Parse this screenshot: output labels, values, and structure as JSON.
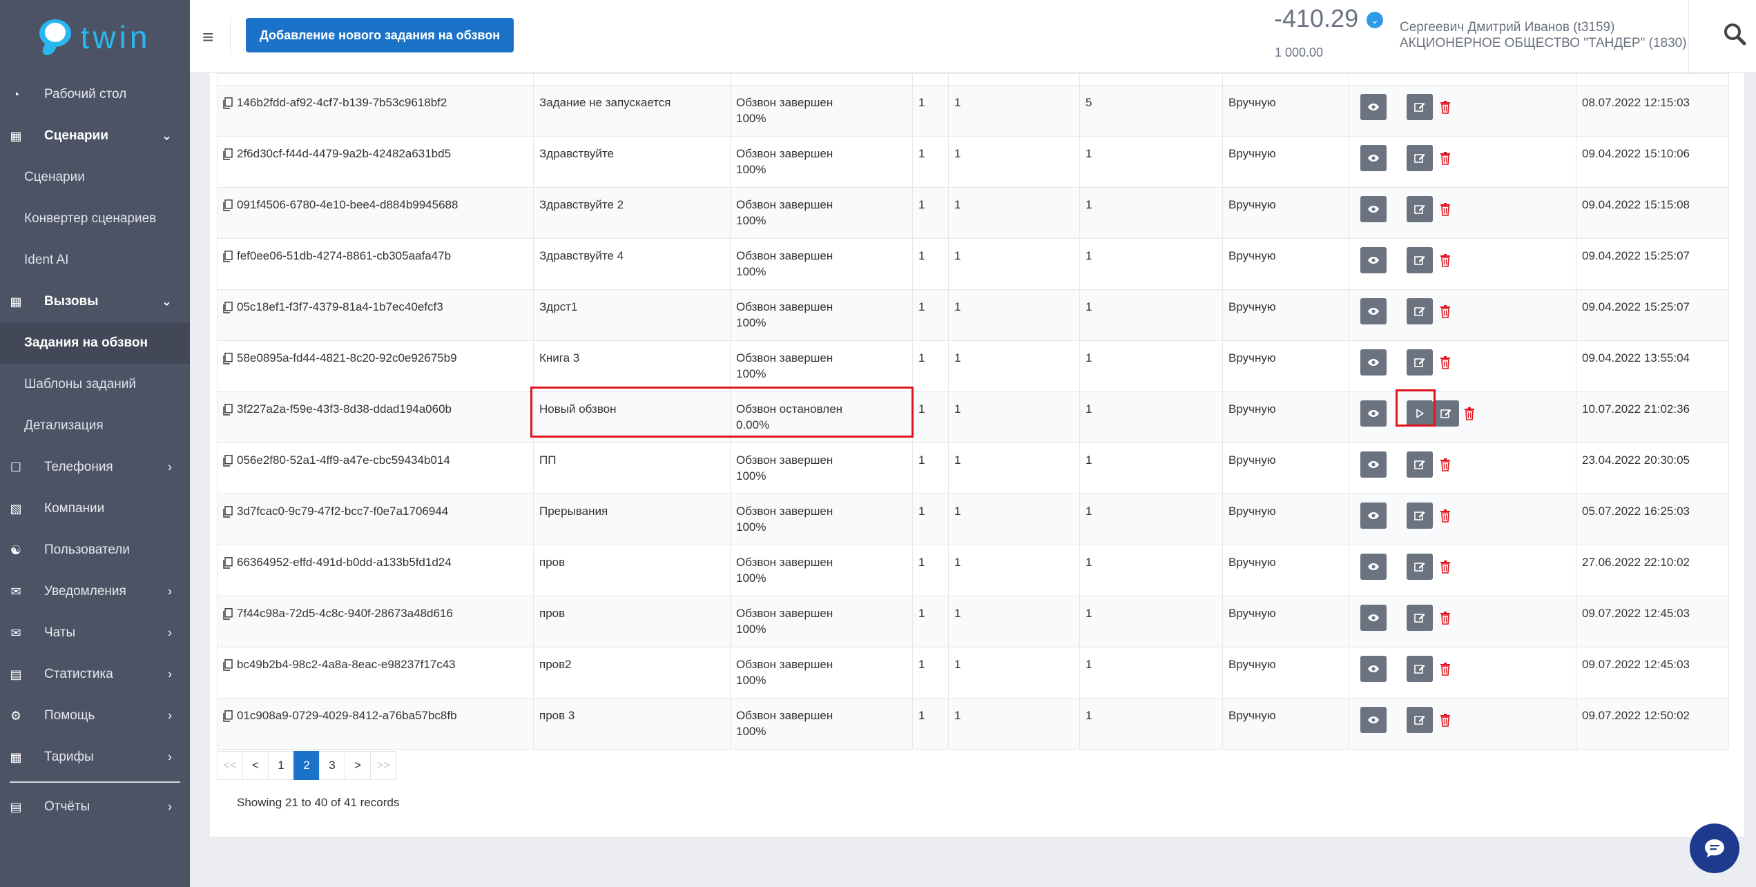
{
  "brand": {
    "name": "twin"
  },
  "sidebar": {
    "items": [
      {
        "label": "Рабочий стол",
        "icon": "dashboard-icon"
      },
      {
        "label": "Сценарии",
        "icon": "scenario-icon",
        "arrow": "chevron-down-icon"
      },
      {
        "label": "Сценарии",
        "sub": true
      },
      {
        "label": "Конвертер сценариев",
        "sub": true
      },
      {
        "label": "Ident AI",
        "sub": true
      },
      {
        "label": "Вызовы",
        "icon": "calendar-icon",
        "arrow": "chevron-down-icon"
      },
      {
        "label": "Задания на обзвон",
        "sub": true,
        "active": true
      },
      {
        "label": "Шаблоны заданий",
        "sub": true
      },
      {
        "label": "Детализация",
        "sub": true
      },
      {
        "label": "Телефония",
        "icon": "phone-icon",
        "arrow": "chevron-right-icon"
      },
      {
        "label": "Компании",
        "icon": "building-icon"
      },
      {
        "label": "Пользователи",
        "icon": "users-icon"
      },
      {
        "label": "Уведомления",
        "icon": "envelope-icon",
        "arrow": "chevron-right-icon"
      },
      {
        "label": "Чаты",
        "icon": "chat-icon",
        "arrow": "chevron-right-icon"
      },
      {
        "label": "Статистика",
        "icon": "bar-chart-icon",
        "arrow": "chevron-right-icon"
      },
      {
        "label": "Помощь",
        "icon": "cogs-icon",
        "arrow": "chevron-right-icon"
      },
      {
        "label": "Тарифы",
        "icon": "calculator-icon",
        "arrow": "chevron-right-icon"
      },
      {
        "label": "Отчёты",
        "icon": "report-chart-icon",
        "arrow": "chevron-right-icon"
      }
    ]
  },
  "header": {
    "add_task_label": "Добавление нового задания на обзвон",
    "balance": "-410.29",
    "credit": "1 000.00",
    "user_name": "Сергеевич Дмитрий Иванов (t3159)",
    "company": "АКЦИОНЕРНОЕ ОБЩЕСТВО \"ТАНДЕР\" (1830)"
  },
  "table": {
    "rows": [
      {
        "id": "146b2fdd-af92-4cf7-b139-7b53c9618bf2",
        "name": "Задание не запускается",
        "status": "Обзвон завершен",
        "progress": "100%",
        "c1": "1",
        "c2": "1",
        "c3": "5",
        "mode": "Вручную",
        "date": "08.07.2022 12:15:03",
        "play": false
      },
      {
        "id": "2f6d30cf-f44d-4479-9a2b-42482a631bd5",
        "name": "Здравствуйте",
        "status": "Обзвон завершен",
        "progress": "100%",
        "c1": "1",
        "c2": "1",
        "c3": "1",
        "mode": "Вручную",
        "date": "09.04.2022 15:10:06",
        "play": false
      },
      {
        "id": "091f4506-6780-4e10-bee4-d884b9945688",
        "name": "Здравствуйте 2",
        "status": "Обзвон завершен",
        "progress": "100%",
        "c1": "1",
        "c2": "1",
        "c3": "1",
        "mode": "Вручную",
        "date": "09.04.2022 15:15:08",
        "play": false
      },
      {
        "id": "fef0ee06-51db-4274-8861-cb305aafa47b",
        "name": "Здравствуйте 4",
        "status": "Обзвон завершен",
        "progress": "100%",
        "c1": "1",
        "c2": "1",
        "c3": "1",
        "mode": "Вручную",
        "date": "09.04.2022 15:25:07",
        "play": false
      },
      {
        "id": "05c18ef1-f3f7-4379-81a4-1b7ec40efcf3",
        "name": "Здрст1",
        "status": "Обзвон завершен",
        "progress": "100%",
        "c1": "1",
        "c2": "1",
        "c3": "1",
        "mode": "Вручную",
        "date": "09.04.2022 15:25:07",
        "play": false
      },
      {
        "id": "58e0895a-fd44-4821-8c20-92c0e92675b9",
        "name": "Книга 3",
        "status": "Обзвон завершен",
        "progress": "100%",
        "c1": "1",
        "c2": "1",
        "c3": "1",
        "mode": "Вручную",
        "date": "09.04.2022 13:55:04",
        "play": false
      },
      {
        "id": "3f227a2a-f59e-43f3-8d38-ddad194a060b",
        "name": "Новый обзвон",
        "status": "Обзвон остановлен",
        "progress": "0.00%",
        "c1": "1",
        "c2": "1",
        "c3": "1",
        "mode": "Вручную",
        "date": "10.07.2022 21:02:36",
        "play": true
      },
      {
        "id": "056e2f80-52a1-4ff9-a47e-cbc59434b014",
        "name": "ПП",
        "status": "Обзвон завершен",
        "progress": "100%",
        "c1": "1",
        "c2": "1",
        "c3": "1",
        "mode": "Вручную",
        "date": "23.04.2022 20:30:05",
        "play": false
      },
      {
        "id": "3d7fcac0-9c79-47f2-bcc7-f0e7a1706944",
        "name": "Прерывания",
        "status": "Обзвон завершен",
        "progress": "100%",
        "c1": "1",
        "c2": "1",
        "c3": "1",
        "mode": "Вручную",
        "date": "05.07.2022 16:25:03",
        "play": false
      },
      {
        "id": "66364952-effd-491d-b0dd-a133b5fd1d24",
        "name": "пров",
        "status": "Обзвон завершен",
        "progress": "100%",
        "c1": "1",
        "c2": "1",
        "c3": "1",
        "mode": "Вручную",
        "date": "27.06.2022 22:10:02",
        "play": false
      },
      {
        "id": "7f44c98a-72d5-4c8c-940f-28673a48d616",
        "name": "пров",
        "status": "Обзвон завершен",
        "progress": "100%",
        "c1": "1",
        "c2": "1",
        "c3": "1",
        "mode": "Вручную",
        "date": "09.07.2022 12:45:03",
        "play": false
      },
      {
        "id": "bc49b2b4-98c2-4a8a-8eac-e98237f17c43",
        "name": "пров2",
        "status": "Обзвон завершен",
        "progress": "100%",
        "c1": "1",
        "c2": "1",
        "c3": "1",
        "mode": "Вручную",
        "date": "09.07.2022 12:45:03",
        "play": false
      },
      {
        "id": "01c908a9-0729-4029-8412-a76ba57bc8fb",
        "name": "пров 3",
        "status": "Обзвон завершен",
        "progress": "100%",
        "c1": "1",
        "c2": "1",
        "c3": "1",
        "mode": "Вручную",
        "date": "09.07.2022 12:50:02",
        "play": false
      }
    ]
  },
  "pagination": {
    "pages": [
      {
        "label": "<<",
        "state": "disabled"
      },
      {
        "label": "<",
        "state": "normal"
      },
      {
        "label": "1",
        "state": "normal"
      },
      {
        "label": "2",
        "state": "current"
      },
      {
        "label": "3",
        "state": "normal"
      },
      {
        "label": ">",
        "state": "normal"
      },
      {
        "label": ">>",
        "state": "disabled"
      }
    ],
    "summary": "Showing 21 to 40 of 41 records"
  },
  "colors": {
    "sidebar_bg": "#4c5364",
    "primary": "#1a73c9",
    "highlight": "#e0141e",
    "delete": "#e0141e",
    "brand": "#2ab7f0"
  }
}
